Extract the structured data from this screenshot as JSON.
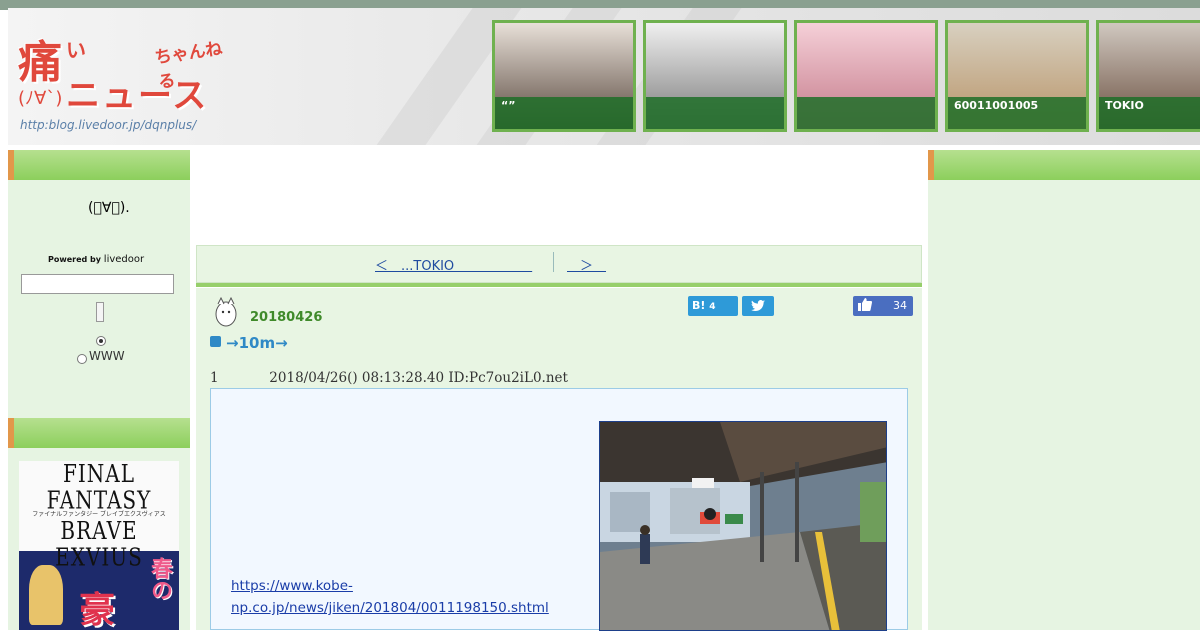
{
  "header": {
    "logo_kanji": "痛",
    "logo_kana": "い",
    "logo_chan": "ちゃんねる",
    "logo_big": "ニュース",
    "logo_face": "(ﾉ∀`)",
    "logo_url": "http:blog.livedoor.jp/dqnplus/"
  },
  "thumbnails": [
    {
      "caption": "“”",
      "color": "#5a4a40"
    },
    {
      "caption": "",
      "color": "#7a7a7a"
    },
    {
      "caption": "",
      "color": "#c47a8a"
    },
    {
      "caption": "60011001005",
      "color": "#b89468"
    },
    {
      "caption": "TOKIO",
      "color": "#6b5040"
    }
  ],
  "sidebar": {
    "face_icon": "(ﾟ∀ﾟ).",
    "powered_by": "Powered by",
    "livedoor": "livedoor",
    "search_value": "",
    "radio_www_label": "WWW",
    "ad_title_line1": "FINAL FANTASY",
    "ad_title_line2": "BRAVE EXVIUS",
    "ad_subtitle": "ファイナルファンタジー ブレイブエクスヴィアス",
    "ad_kanji1": "豪",
    "ad_kanji2": "春の"
  },
  "nav": {
    "prev_label": "＜　...TOKIO　　　　　　",
    "next_label": "　＞　"
  },
  "post": {
    "date": "20180426",
    "hatena_label": "B!",
    "hatena_count": "4",
    "facebook_count": "34",
    "title": "→10m→",
    "res_number": "1",
    "res_meta": "2018/04/26() 08:13:28.40 ID:Pc7ou2iL0.net",
    "link": "https://www.kobe-np.co.jp/news/jiken/201804/0011198150.shtml"
  },
  "colors": {
    "accent_green": "#8ccf5c",
    "link_blue": "#1a3da8",
    "title_blue": "#2f89c6",
    "date_green": "#3f8a2a"
  }
}
